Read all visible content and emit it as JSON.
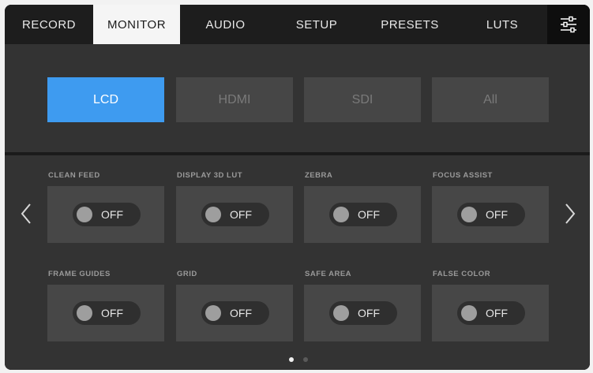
{
  "tabs": [
    {
      "label": "RECORD",
      "active": false
    },
    {
      "label": "MONITOR",
      "active": true
    },
    {
      "label": "AUDIO",
      "active": false
    },
    {
      "label": "SETUP",
      "active": false
    },
    {
      "label": "PRESETS",
      "active": false
    },
    {
      "label": "LUTS",
      "active": false
    }
  ],
  "settings_icon": "sliders-icon",
  "outputs": [
    {
      "label": "LCD",
      "active": true
    },
    {
      "label": "HDMI",
      "active": false
    },
    {
      "label": "SDI",
      "active": false
    },
    {
      "label": "All",
      "active": false
    }
  ],
  "toggles": [
    {
      "label": "CLEAN FEED",
      "state": "OFF"
    },
    {
      "label": "DISPLAY 3D LUT",
      "state": "OFF"
    },
    {
      "label": "ZEBRA",
      "state": "OFF"
    },
    {
      "label": "FOCUS ASSIST",
      "state": "OFF"
    },
    {
      "label": "FRAME GUIDES",
      "state": "OFF"
    },
    {
      "label": "GRID",
      "state": "OFF"
    },
    {
      "label": "SAFE AREA",
      "state": "OFF"
    },
    {
      "label": "FALSE COLOR",
      "state": "OFF"
    }
  ],
  "pagination": {
    "pages": 2,
    "current": 1
  },
  "colors": {
    "accent": "#3e9bf0",
    "panel": "#333333",
    "tile": "#474747"
  }
}
